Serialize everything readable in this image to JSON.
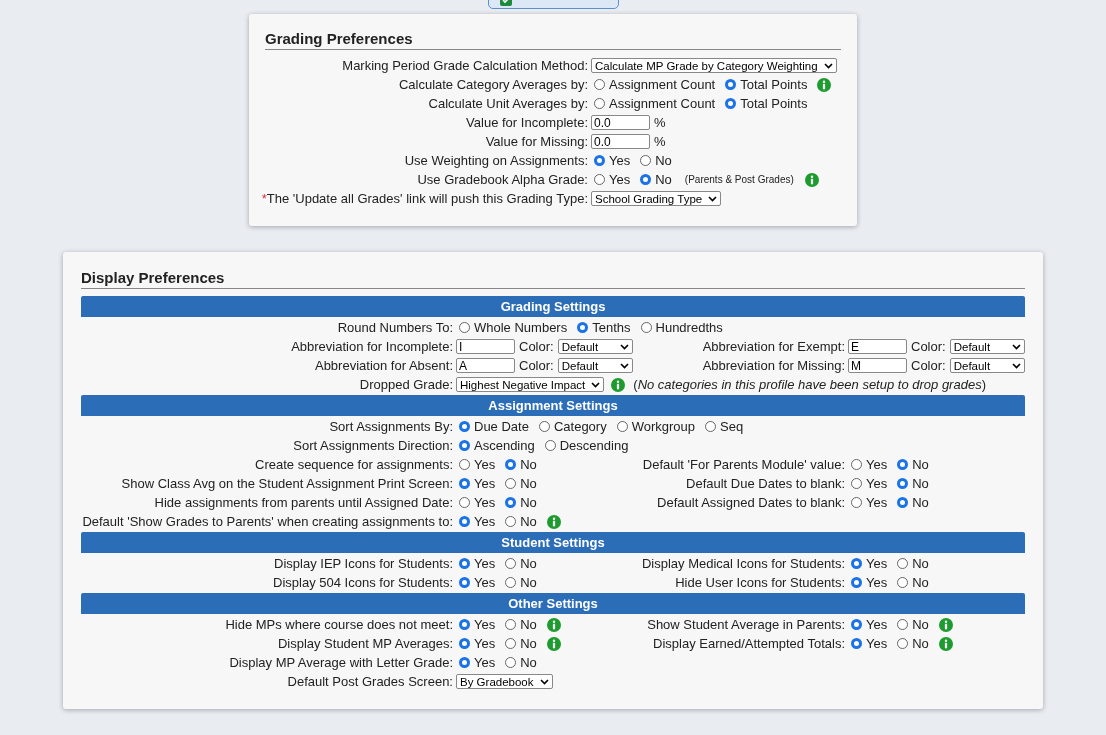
{
  "grading": {
    "title": "Grading Preferences",
    "rows": [
      {
        "label": "Marking Period Grade Calculation Method:",
        "controls": [
          {
            "kind": "select",
            "value": "Calculate MP Grade by Category Weighting"
          }
        ]
      },
      {
        "label": "Calculate Category Averages by:",
        "controls": [
          {
            "kind": "radio",
            "label": "Assignment Count",
            "selected": false
          },
          {
            "kind": "radio",
            "label": "Total Points",
            "selected": true
          },
          {
            "kind": "info"
          }
        ]
      },
      {
        "label": "Calculate Unit Averages by:",
        "controls": [
          {
            "kind": "radio",
            "label": "Assignment Count",
            "selected": false
          },
          {
            "kind": "radio",
            "label": "Total Points",
            "selected": true
          }
        ]
      },
      {
        "label": "Value for Incomplete:",
        "controls": [
          {
            "kind": "input",
            "value": "0.0"
          },
          {
            "kind": "text",
            "text": "%"
          }
        ]
      },
      {
        "label": "Value for Missing:",
        "controls": [
          {
            "kind": "input",
            "value": "0.0"
          },
          {
            "kind": "text",
            "text": "%"
          }
        ]
      },
      {
        "label": "Use Weighting on Assignments:",
        "controls": [
          {
            "kind": "radio",
            "label": "Yes",
            "selected": true
          },
          {
            "kind": "radio",
            "label": "No",
            "selected": false
          }
        ]
      },
      {
        "label": "Use Gradebook Alpha Grade:",
        "controls": [
          {
            "kind": "radio",
            "label": "Yes",
            "selected": false
          },
          {
            "kind": "radio",
            "label": "No",
            "selected": true
          },
          {
            "kind": "note",
            "text": "(Parents & Post Grades)"
          },
          {
            "kind": "info"
          }
        ]
      },
      {
        "marker": "*",
        "label": "The 'Update all Grades' link will push this Grading Type:",
        "controls": [
          {
            "kind": "select",
            "value": "School Grading Type"
          }
        ]
      }
    ]
  },
  "display": {
    "title": "Display Preferences",
    "sections": [
      {
        "title": "Grading Settings",
        "rows": [
          {
            "label": "Round Numbers To:",
            "controls": [
              {
                "kind": "radio",
                "label": "Whole Numbers",
                "selected": false
              },
              {
                "kind": "radio",
                "label": "Tenths",
                "selected": true
              },
              {
                "kind": "radio",
                "label": "Hundredths",
                "selected": false
              }
            ]
          },
          {
            "label": "Abbreviation for Incomplete:",
            "controls": [
              {
                "kind": "input",
                "value": "I"
              },
              {
                "kind": "text",
                "text": "Color:"
              },
              {
                "kind": "select",
                "value": "Default"
              }
            ],
            "right": {
              "label": "Abbreviation for Exempt:",
              "controls": [
                {
                  "kind": "input",
                  "value": "E"
                },
                {
                  "kind": "text",
                  "text": "Color:"
                },
                {
                  "kind": "select",
                  "value": "Default"
                }
              ]
            }
          },
          {
            "label": "Abbreviation for Absent:",
            "controls": [
              {
                "kind": "input",
                "value": "A"
              },
              {
                "kind": "text",
                "text": "Color:"
              },
              {
                "kind": "select",
                "value": "Default"
              }
            ],
            "right": {
              "label": "Abbreviation for Missing:",
              "controls": [
                {
                  "kind": "input",
                  "value": "M"
                },
                {
                  "kind": "text",
                  "text": "Color:"
                },
                {
                  "kind": "select",
                  "value": "Default"
                }
              ]
            }
          },
          {
            "label": "Dropped Grade:",
            "controls": [
              {
                "kind": "select",
                "value": "Highest Negative Impact"
              },
              {
                "kind": "info"
              },
              {
                "kind": "hint",
                "text": "(*No categories in this profile have been setup to drop grades*)"
              }
            ]
          }
        ]
      },
      {
        "title": "Assignment Settings",
        "rows": [
          {
            "label": "Sort Assignments By:",
            "controls": [
              {
                "kind": "radio",
                "label": "Due Date",
                "selected": true
              },
              {
                "kind": "radio",
                "label": "Category",
                "selected": false
              },
              {
                "kind": "radio",
                "label": "Workgroup",
                "selected": false
              },
              {
                "kind": "radio",
                "label": "Seq",
                "selected": false
              }
            ]
          },
          {
            "label": "Sort Assignments Direction:",
            "controls": [
              {
                "kind": "radio",
                "label": "Ascending",
                "selected": true
              },
              {
                "kind": "radio",
                "label": "Descending",
                "selected": false
              }
            ]
          },
          {
            "label": "Create sequence for assignments:",
            "controls": [
              {
                "kind": "radio",
                "label": "Yes",
                "selected": false
              },
              {
                "kind": "radio",
                "label": "No",
                "selected": true
              }
            ],
            "right": {
              "label": "Default 'For Parents Module' value:",
              "controls": [
                {
                  "kind": "radio",
                  "label": "Yes",
                  "selected": false
                },
                {
                  "kind": "radio",
                  "label": "No",
                  "selected": true
                }
              ]
            }
          },
          {
            "label": "Show Class Avg on the Student Assignment Print Screen:",
            "controls": [
              {
                "kind": "radio",
                "label": "Yes",
                "selected": true
              },
              {
                "kind": "radio",
                "label": "No",
                "selected": false
              }
            ],
            "right": {
              "label": "Default Due Dates to blank:",
              "controls": [
                {
                  "kind": "radio",
                  "label": "Yes",
                  "selected": false
                },
                {
                  "kind": "radio",
                  "label": "No",
                  "selected": true
                }
              ]
            }
          },
          {
            "label": "Hide assignments from parents until Assigned Date:",
            "controls": [
              {
                "kind": "radio",
                "label": "Yes",
                "selected": false
              },
              {
                "kind": "radio",
                "label": "No",
                "selected": true
              }
            ],
            "right": {
              "label": "Default Assigned Dates to blank:",
              "controls": [
                {
                  "kind": "radio",
                  "label": "Yes",
                  "selected": false
                },
                {
                  "kind": "radio",
                  "label": "No",
                  "selected": true
                }
              ]
            }
          },
          {
            "label": "Default 'Show Grades to Parents' when creating assignments to:",
            "controls": [
              {
                "kind": "radio",
                "label": "Yes",
                "selected": true
              },
              {
                "kind": "radio",
                "label": "No",
                "selected": false
              },
              {
                "kind": "info"
              }
            ]
          }
        ]
      },
      {
        "title": "Student Settings",
        "rows": [
          {
            "label": "Display IEP Icons for Students:",
            "controls": [
              {
                "kind": "radio",
                "label": "Yes",
                "selected": true
              },
              {
                "kind": "radio",
                "label": "No",
                "selected": false
              }
            ],
            "right": {
              "label": "Display Medical Icons for Students:",
              "controls": [
                {
                  "kind": "radio",
                  "label": "Yes",
                  "selected": true
                },
                {
                  "kind": "radio",
                  "label": "No",
                  "selected": false
                }
              ]
            }
          },
          {
            "label": "Display 504 Icons for Students:",
            "controls": [
              {
                "kind": "radio",
                "label": "Yes",
                "selected": true
              },
              {
                "kind": "radio",
                "label": "No",
                "selected": false
              }
            ],
            "right": {
              "label": "Hide User Icons for Students:",
              "controls": [
                {
                  "kind": "radio",
                  "label": "Yes",
                  "selected": true
                },
                {
                  "kind": "radio",
                  "label": "No",
                  "selected": false
                }
              ]
            }
          }
        ]
      },
      {
        "title": "Other Settings",
        "rows": [
          {
            "label": "Hide MPs where course does not meet:",
            "controls": [
              {
                "kind": "radio",
                "label": "Yes",
                "selected": true
              },
              {
                "kind": "radio",
                "label": "No",
                "selected": false
              },
              {
                "kind": "info"
              }
            ],
            "right": {
              "label": "Show Student Average in Parents:",
              "controls": [
                {
                  "kind": "radio",
                  "label": "Yes",
                  "selected": true
                },
                {
                  "kind": "radio",
                  "label": "No",
                  "selected": false
                },
                {
                  "kind": "info"
                }
              ]
            }
          },
          {
            "label": "Display Student MP Averages:",
            "controls": [
              {
                "kind": "radio",
                "label": "Yes",
                "selected": true
              },
              {
                "kind": "radio",
                "label": "No",
                "selected": false
              },
              {
                "kind": "info"
              }
            ],
            "right": {
              "label": "Display Earned/Attempted Totals:",
              "controls": [
                {
                  "kind": "radio",
                  "label": "Yes",
                  "selected": true
                },
                {
                  "kind": "radio",
                  "label": "No",
                  "selected": false
                },
                {
                  "kind": "info"
                }
              ]
            }
          },
          {
            "label": "Display MP Average with Letter Grade:",
            "controls": [
              {
                "kind": "radio",
                "label": "Yes",
                "selected": true
              },
              {
                "kind": "radio",
                "label": "No",
                "selected": false
              }
            ]
          },
          {
            "label": "Default Post Grades Screen:",
            "controls": [
              {
                "kind": "select",
                "value": "By Gradebook"
              }
            ]
          }
        ]
      }
    ]
  }
}
